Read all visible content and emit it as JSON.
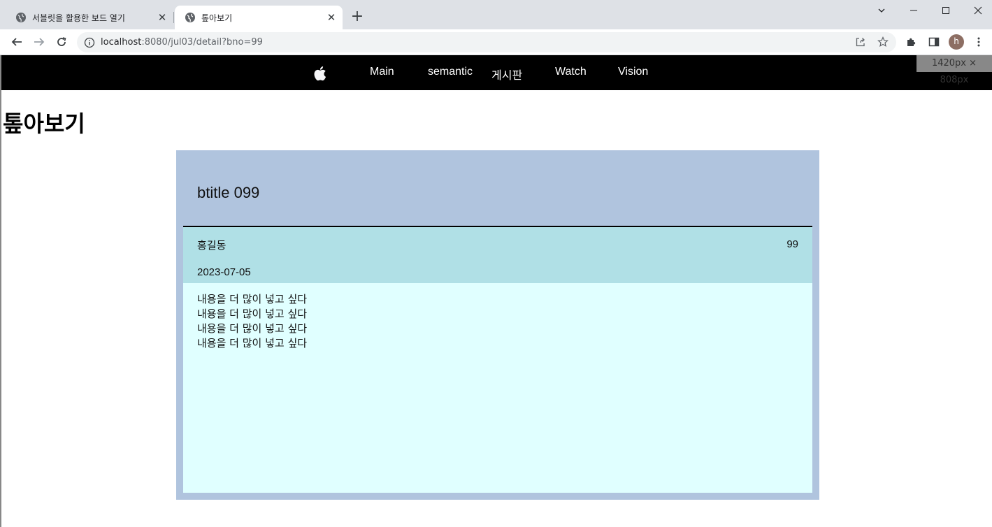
{
  "browser": {
    "tabs": [
      {
        "title": "서블릿을 활용한 보드 열기",
        "active": false
      },
      {
        "title": "톺아보기",
        "active": true
      }
    ],
    "url": {
      "host": "localhost",
      "rest": ":8080/jul03/detail?bno=99"
    },
    "profile_initial": "h",
    "viewport_badge": "1420px × 808px"
  },
  "nav": {
    "logo_icon": "apple-icon",
    "items": [
      "Main",
      "semantic",
      "게시판",
      "Watch",
      "Vision"
    ]
  },
  "page": {
    "title": "톺아보기"
  },
  "post": {
    "title": "btitle 099",
    "writer": "홍길동",
    "count": "99",
    "date": "2023-07-05",
    "content_lines": [
      "내용을 더 많이 넣고 싶다",
      "내용을 더 많이 넣고 싶다",
      "내용을 더 많이 넣고 싶다",
      "내용을 더 많이 넣고 싶다"
    ]
  },
  "colors": {
    "nav_bg": "#000000",
    "card_bg": "#b0c4de",
    "meta_bg": "#b0e0e6",
    "content_bg": "#e0ffff"
  }
}
